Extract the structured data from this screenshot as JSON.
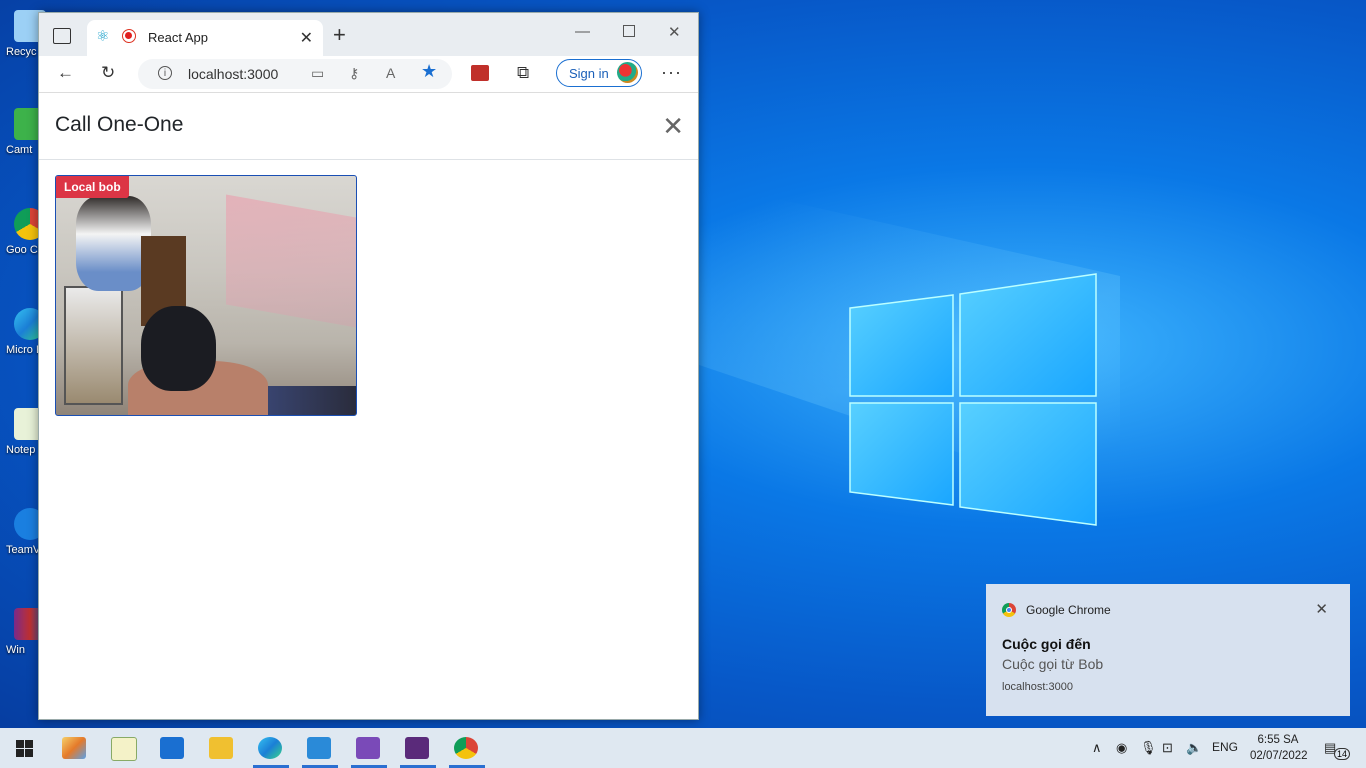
{
  "desktop": {
    "icons": [
      "Recyc",
      "Camt",
      "Goo Chro",
      "Micro Ed",
      "Notep",
      "TeamV",
      "Win"
    ]
  },
  "browser": {
    "tab": {
      "title": "React App"
    },
    "address": {
      "url": "localhost:3000"
    },
    "signin_label": "Sign in"
  },
  "modal": {
    "title": "Call One-One",
    "video_badge": "Local bob"
  },
  "notification": {
    "app": "Google Chrome",
    "heading": "Cuộc gọi đến",
    "body": "Cuộc gọi từ Bob",
    "source": "localhost:3000"
  },
  "taskbar": {
    "lang": "ENG",
    "time": "6:55 SA",
    "date": "02/07/2022",
    "notif_count": "14"
  },
  "colors": {
    "accent": "#1a6fd1",
    "badge": "#dc3545"
  }
}
